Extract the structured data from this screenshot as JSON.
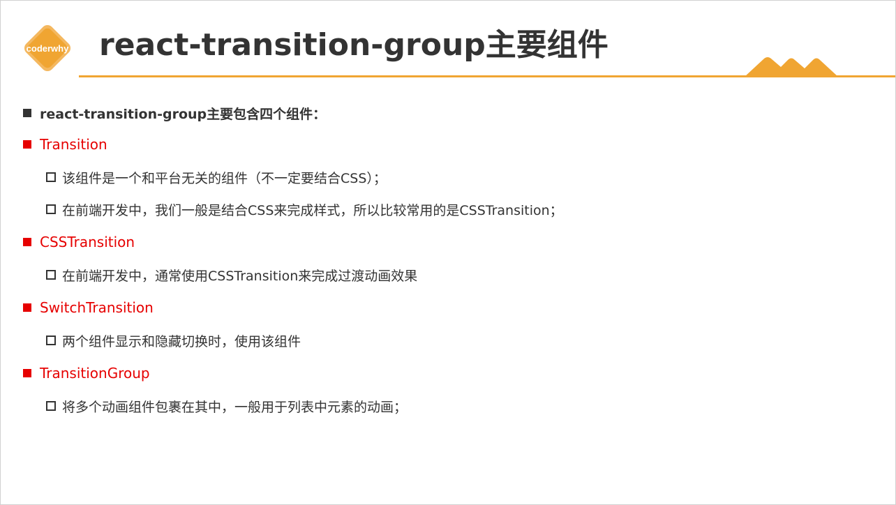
{
  "logo": {
    "text": "coderwhy",
    "color": "#f0a532"
  },
  "title": "react-transition-group主要组件",
  "intro": "react-transition-group主要包含四个组件：",
  "colors": {
    "accent": "#f0a532",
    "section": "#e60000",
    "text": "#333333"
  },
  "sections": [
    {
      "label": "Transition",
      "items": [
        "该组件是一个和平台无关的组件（不一定要结合CSS）；",
        "在前端开发中，我们一般是结合CSS来完成样式，所以比较常用的是CSSTransition；"
      ]
    },
    {
      "label": "CSSTransition",
      "items": [
        "在前端开发中，通常使用CSSTransition来完成过渡动画效果"
      ]
    },
    {
      "label": "SwitchTransition",
      "items": [
        "两个组件显示和隐藏切换时，使用该组件"
      ]
    },
    {
      "label": "TransitionGroup",
      "items": [
        "将多个动画组件包裹在其中，一般用于列表中元素的动画；"
      ]
    }
  ]
}
